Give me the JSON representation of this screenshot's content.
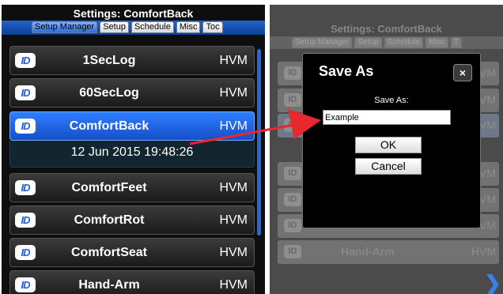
{
  "left": {
    "title": "Settings: ComfortBack",
    "tabs": [
      "Setup Manager",
      "Setup",
      "Schedule",
      "Misc",
      "Toc"
    ],
    "active_tab_index": 0,
    "rows": [
      {
        "name": "1SecLog",
        "type": "HVM"
      },
      {
        "name": "60SecLog",
        "type": "HVM"
      },
      {
        "name": "ComfortBack",
        "type": "HVM",
        "selected": true,
        "detail": "12 Jun 2015 19:48:26"
      },
      {
        "name": "ComfortFeet",
        "type": "HVM"
      },
      {
        "name": "ComfortRot",
        "type": "HVM"
      },
      {
        "name": "ComfortSeat",
        "type": "HVM"
      },
      {
        "name": "Hand-Arm",
        "type": "HVM"
      }
    ],
    "logo_text": "ID"
  },
  "right": {
    "title": "Settings: ComfortBack",
    "tabs": [
      "Setup Manager",
      "Setup",
      "Schedule",
      "Misc",
      "T"
    ],
    "ghost_row_tail": "VM",
    "ghost_row_name": "Hand-Arm",
    "ghost_row_type": "HVM"
  },
  "dialog": {
    "title": "Save As",
    "close_glyph": "×",
    "label": "Save As:",
    "value": "Example",
    "ok_label": "OK",
    "cancel_label": "Cancel"
  },
  "colors": {
    "accent": "#2f7dff",
    "arrow": "#e8282e",
    "panel_bg": "#0e0e0e"
  },
  "icons": {
    "logo": "id-logo-icon",
    "close": "close-icon",
    "next": "chevron-right-icon",
    "annotation": "red-arrow-icon"
  }
}
